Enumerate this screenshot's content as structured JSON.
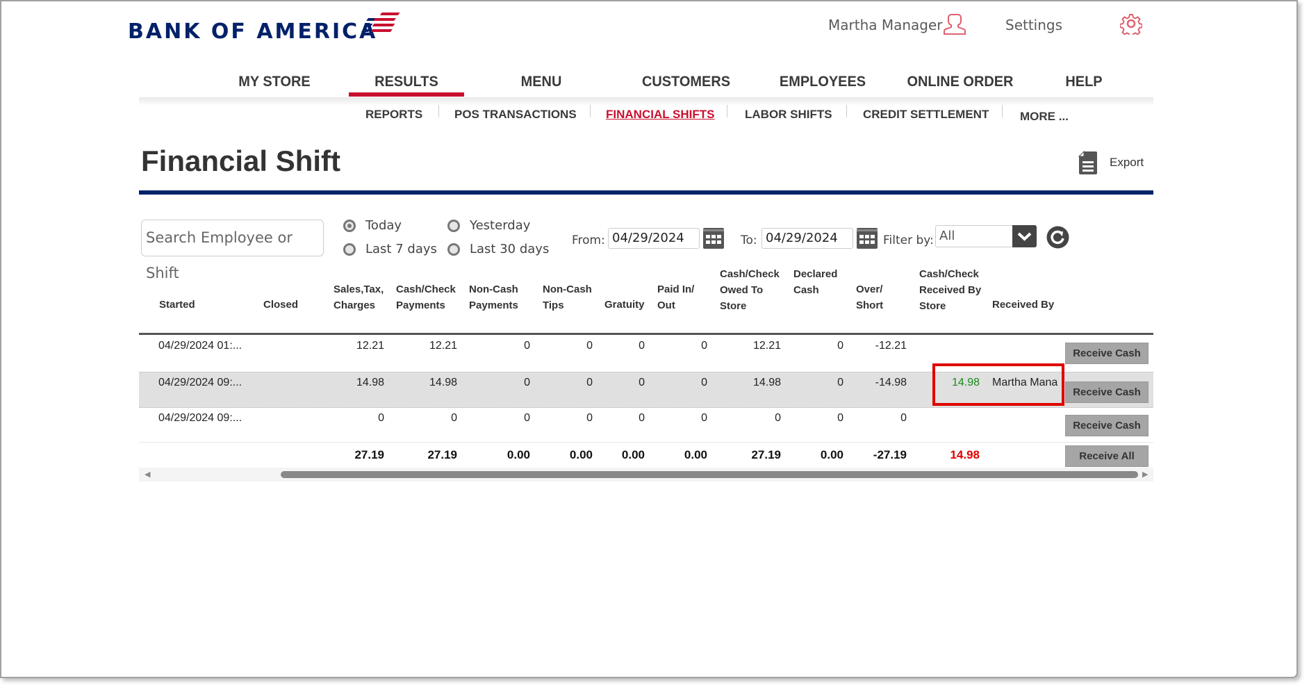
{
  "brand": {
    "name": "BANK OF AMERICA",
    "primary_color": "#012169",
    "accent_color": "#c8102e"
  },
  "header": {
    "user_name": "Martha Manager",
    "settings_label": "Settings"
  },
  "main_nav": [
    {
      "label": "MY STORE",
      "active": false
    },
    {
      "label": "RESULTS",
      "active": true
    },
    {
      "label": "MENU",
      "active": false
    },
    {
      "label": "CUSTOMERS",
      "active": false
    },
    {
      "label": "EMPLOYEES",
      "active": false
    },
    {
      "label": "ONLINE ORDER",
      "active": false
    },
    {
      "label": "HELP",
      "active": false
    }
  ],
  "sub_nav": [
    {
      "label": "REPORTS",
      "active": false
    },
    {
      "label": "POS TRANSACTIONS",
      "active": false
    },
    {
      "label": "FINANCIAL SHIFTS",
      "active": true
    },
    {
      "label": "LABOR SHIFTS",
      "active": false
    },
    {
      "label": "CREDIT SETTLEMENT",
      "active": false
    },
    {
      "label": "MORE ...",
      "active": false
    }
  ],
  "page": {
    "title": "Financial Shift",
    "export_label": "Export"
  },
  "filters": {
    "search_placeholder": "Search Employee or Shift",
    "ranges": [
      {
        "label": "Today",
        "selected": true
      },
      {
        "label": "Yesterday",
        "selected": false
      },
      {
        "label": "Last 7 days",
        "selected": false
      },
      {
        "label": "Last 30 days",
        "selected": false
      }
    ],
    "from_label": "From:",
    "from_value": "04/29/2024",
    "to_label": "To:",
    "to_value": "04/29/2024",
    "filter_label": "Filter by:",
    "filter_value": "All"
  },
  "table": {
    "columns": [
      "Started",
      "Closed",
      "Sales,Tax, Charges",
      "Cash/Check Payments",
      "Non-Cash Payments",
      "Non-Cash Tips",
      "Gratuity",
      "Paid In/ Out",
      "Cash/Check Owed To Store",
      "Declared Cash",
      "Over/ Short",
      "Cash/Check Received By Store",
      "Received By"
    ],
    "header_lines": {
      "started": [
        "Started"
      ],
      "closed": [
        "Closed"
      ],
      "sales": [
        "Sales,Tax,",
        "Charges"
      ],
      "cashpay": [
        "Cash/Check",
        "Payments"
      ],
      "noncashpay": [
        "Non-Cash",
        "Payments"
      ],
      "noncashtips": [
        "Non-Cash",
        "Tips"
      ],
      "gratuity": [
        "Gratuity"
      ],
      "paidin": [
        "Paid In/",
        "Out"
      ],
      "owed": [
        "Cash/Check",
        "Owed To",
        "Store"
      ],
      "declared": [
        "Declared",
        "Cash"
      ],
      "overshort": [
        "Over/",
        "Short"
      ],
      "received": [
        "Cash/Check",
        "Received By",
        "Store"
      ],
      "receivedby": [
        "Received By"
      ]
    },
    "rows": [
      {
        "started": "04/29/2024 01:...",
        "closed": "",
        "sales": "12.21",
        "cashpay": "12.21",
        "noncashpay": "0",
        "noncashtips": "0",
        "gratuity": "0",
        "paidin": "0",
        "owed": "12.21",
        "declared": "0",
        "overshort": "-12.21",
        "received": "",
        "receivedby": "",
        "action": "Receive Cash"
      },
      {
        "started": "04/29/2024 09:...",
        "closed": "",
        "sales": "14.98",
        "cashpay": "14.98",
        "noncashpay": "0",
        "noncashtips": "0",
        "gratuity": "0",
        "paidin": "0",
        "owed": "14.98",
        "declared": "0",
        "overshort": "-14.98",
        "received": "14.98",
        "receivedby": "Martha Mana",
        "action": "Receive Cash"
      },
      {
        "started": "04/29/2024 09:...",
        "closed": "",
        "sales": "0",
        "cashpay": "0",
        "noncashpay": "0",
        "noncashtips": "0",
        "gratuity": "0",
        "paidin": "0",
        "owed": "0",
        "declared": "0",
        "overshort": "0",
        "received": "",
        "receivedby": "",
        "action": "Receive Cash"
      }
    ],
    "totals": {
      "sales": "27.19",
      "cashpay": "27.19",
      "noncashpay": "0.00",
      "noncashtips": "0.00",
      "gratuity": "0.00",
      "paidin": "0.00",
      "owed": "27.19",
      "declared": "0.00",
      "overshort": "-27.19",
      "received": "14.98",
      "action": "Receive All"
    },
    "received_color": "#1a8a1a",
    "total_received_color": "#e00000"
  }
}
